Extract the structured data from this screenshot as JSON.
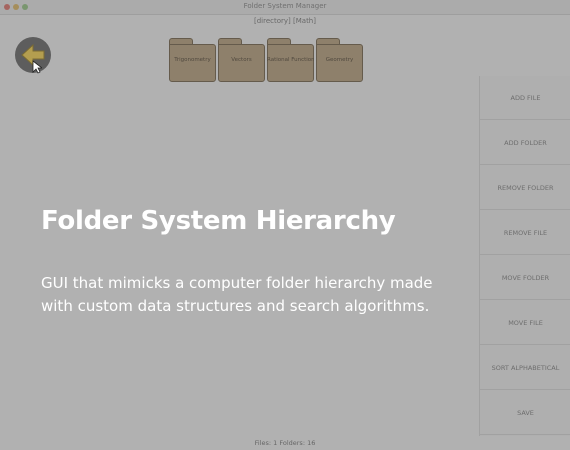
{
  "window": {
    "title": "Folder System Manager"
  },
  "path": "[directory] [Math]",
  "back_button": {
    "icon": "back-arrow-icon"
  },
  "folders": [
    {
      "label": "Trigonometry"
    },
    {
      "label": "Vectors"
    },
    {
      "label": "Rational Functions"
    },
    {
      "label": "Geometry"
    }
  ],
  "sidebar": {
    "buttons": [
      {
        "label": "ADD FILE"
      },
      {
        "label": "ADD FOLDER"
      },
      {
        "label": "REMOVE FOLDER"
      },
      {
        "label": "REMOVE FILE"
      },
      {
        "label": "MOVE FOLDER"
      },
      {
        "label": "MOVE FILE"
      },
      {
        "label": "SORT ALPHABETICAL"
      },
      {
        "label": "SAVE"
      }
    ]
  },
  "status": "Files: 1 Folders: 16",
  "overlay": {
    "headline": "Folder System Hierarchy",
    "description": "GUI that mimicks a computer folder hierarchy made with custom data structures and search algorithms."
  },
  "colors": {
    "folder": "#a89373",
    "accent_arrow": "#e0bf4a",
    "overlay_text": "#ffffff"
  }
}
